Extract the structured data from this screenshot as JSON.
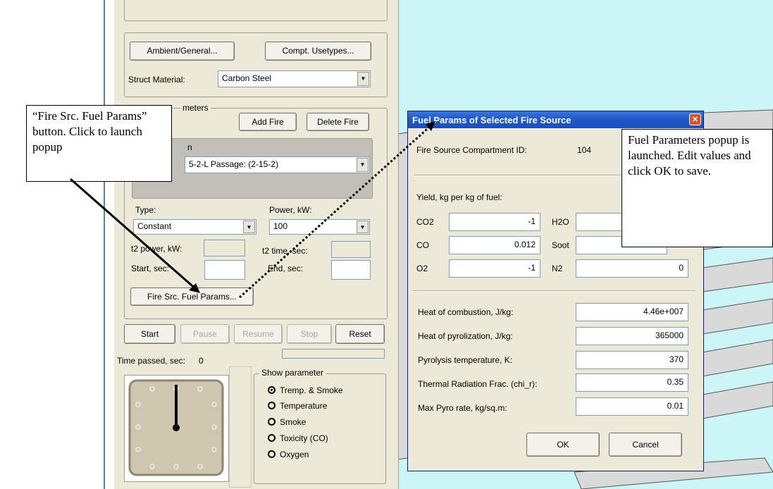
{
  "main_panel": {
    "ambient_button": "Ambient/General...",
    "usetypes_button": "Compt. Usetypes...",
    "struct_material_label": "Struct Material:",
    "struct_material_value": "Carbon Steel",
    "fire_group_label": "meters",
    "add_fire_button": "Add Fire",
    "delete_fire_button": "Delete Fire",
    "fire_list_label": "n",
    "fire_list_value": "5-2-L Passage: (2-15-2)",
    "type_label": "Type:",
    "type_value": "Constant",
    "power_label": "Power, kW:",
    "power_value": "100",
    "t2_power_label": "t2 power, kW:",
    "t2_time_label": "t2 time, sec:",
    "start_label": "Start, sec:",
    "end_label": "End, sec:",
    "fuel_params_button": "Fire Src. Fuel Params...",
    "start_button": "Start",
    "pause_button": "Pause",
    "resume_button": "Resume",
    "stop_button": "Stop",
    "reset_button": "Reset",
    "time_passed_label": "Time passed, sec:",
    "time_passed_value": "0",
    "show_param_label": "Show parameter",
    "show_options": [
      "Tremp. & Smoke",
      "Temperature",
      "Smoke",
      "Toxicity (CO)",
      "Oxygen"
    ],
    "show_selected_index": 0
  },
  "dialog": {
    "title": "Fuel Params of Selected Fire Source",
    "compartment_label": "Fire Source Compartment ID:",
    "compartment_value": "104",
    "yield_label": "Yield, kg per kg of fuel:",
    "co2_label": "CO2",
    "co2_value": "-1",
    "h2o_label": "H2O",
    "co_label": "CO",
    "co_value": "0.012",
    "soot_label": "Soot",
    "o2_label": "O2",
    "o2_value": "-1",
    "n2_label": "N2",
    "n2_value": "0",
    "heat_combustion_label": "Heat of combustion, J/kg:",
    "heat_combustion_value": "4.46e+007",
    "heat_pyrolization_label": "Heat of pyrolization, J/kg:",
    "heat_pyrolization_value": "365000",
    "pyro_temp_label": "Pyrolysis temperature, K:",
    "pyro_temp_value": "370",
    "thermal_rad_label": "Thermal Radiation Frac. (chi_r):",
    "thermal_rad_value": "0.35",
    "max_pyro_label": "Max Pyro rate, kg/sq.m:",
    "max_pyro_value": "0.01",
    "ok_button": "OK",
    "cancel_button": "Cancel"
  },
  "callouts": {
    "left": "“Fire Src. Fuel Params” button. Click to launch popup",
    "right": "Fuel Parameters popup is launched. Edit values and click OK to save."
  },
  "colors": {
    "panel_bg": "#ece9d8",
    "viewport_bg": "#ccf5f8",
    "titlebar": "#1d58c8"
  }
}
